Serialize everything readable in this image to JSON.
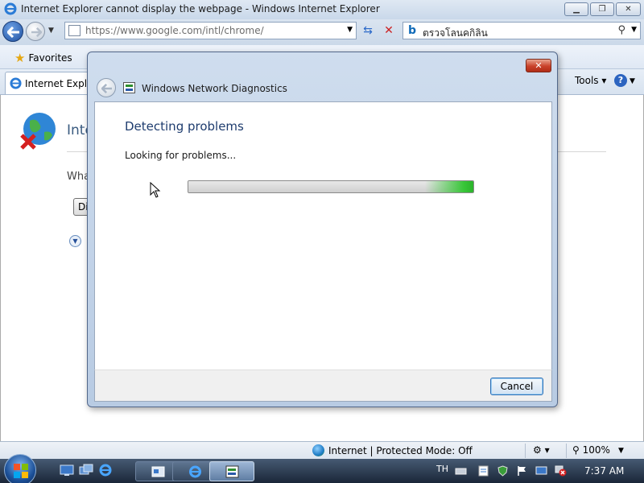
{
  "browser": {
    "title": "Internet Explorer cannot display the webpage - Windows Internet Explorer",
    "address": "https://www.google.com/intl/chrome/",
    "search_text": "ตรวจโลนคกิลิน",
    "favorites_label": "Favorites",
    "tab_label": "Internet Explorer",
    "tools_label": "Tools",
    "page": {
      "heading": "Internet Explorer",
      "body_text": "What you can try:",
      "diagnose_button": "Diagnose Connection Problems"
    }
  },
  "status_bar": {
    "zone": "Internet | Protected Mode: Off",
    "zoom": "100%"
  },
  "dialog": {
    "title": "Windows Network Diagnostics",
    "heading": "Detecting problems",
    "status": "Looking for problems...",
    "progress": 1.0,
    "cancel_label": "Cancel"
  },
  "taskbar": {
    "language": "TH",
    "clock": "7:37 AM"
  },
  "colors": {
    "accent": "#1e3c6e",
    "progress_green": "#39c639",
    "close_red": "#c9422a"
  }
}
